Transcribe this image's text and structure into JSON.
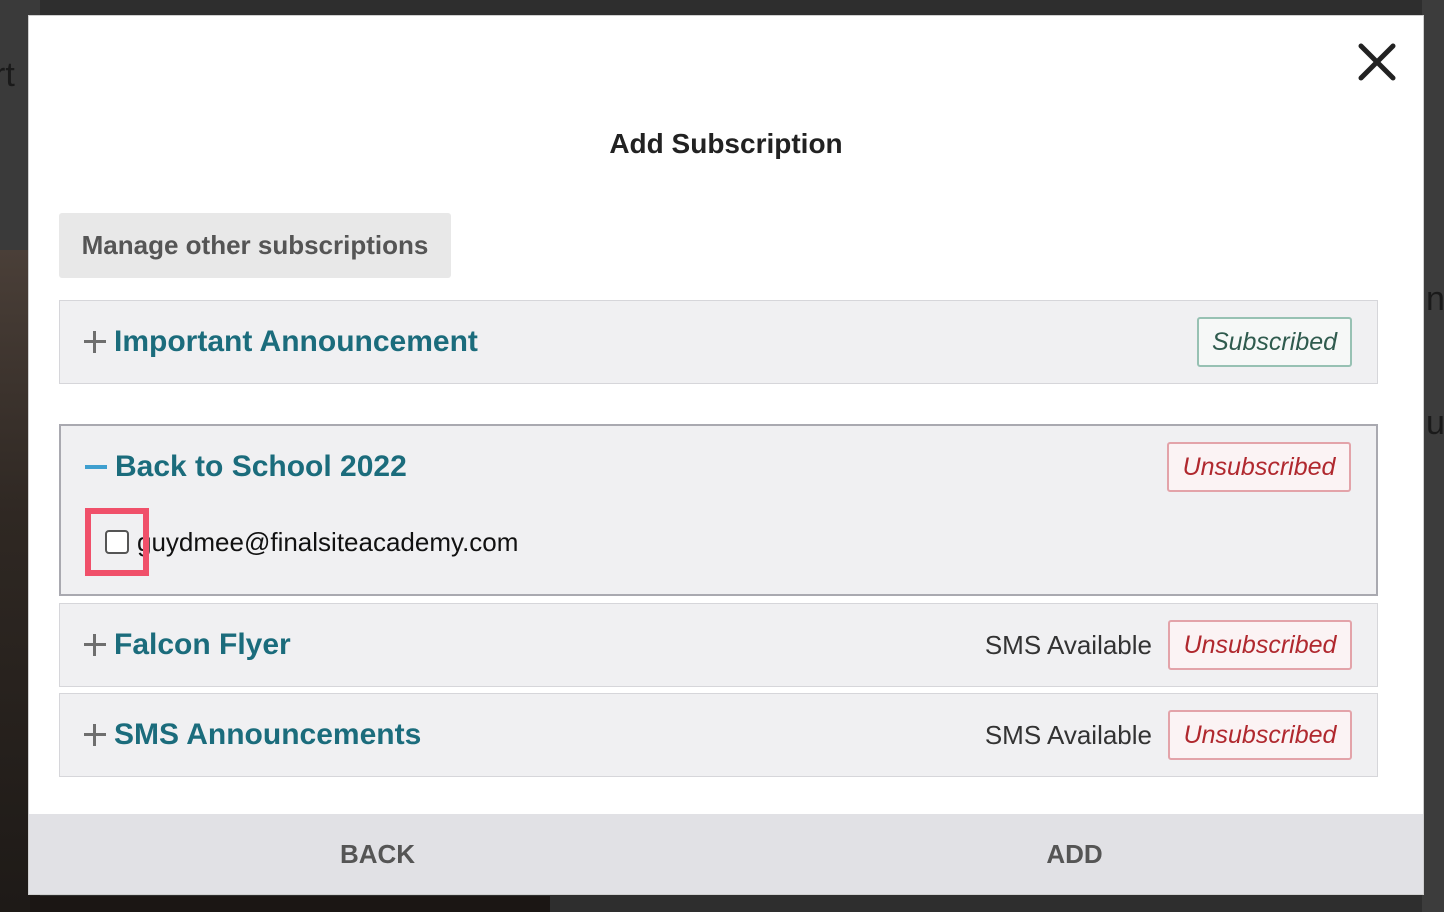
{
  "dialog": {
    "title": "Add Subscription",
    "manage_button": "Manage other subscriptions",
    "sms_label": "SMS Available",
    "subscriptions": [
      {
        "name": "Important Announcement",
        "status": "Subscribed",
        "expanded": false
      },
      {
        "name": "Back to School 2022",
        "status": "Unsubscribed",
        "expanded": true,
        "email": "guydmee@finalsiteacademy.com"
      },
      {
        "name": "Falcon Flyer",
        "status": "Unsubscribed",
        "expanded": false,
        "sms": true
      },
      {
        "name": "SMS Announcements",
        "status": "Unsubscribed",
        "expanded": false,
        "sms": true
      }
    ],
    "footer": {
      "back": "BACK",
      "add": "ADD"
    },
    "icons": {
      "close": "close-icon",
      "plus": "plus-icon",
      "minus": "minus-icon"
    },
    "colors": {
      "title_teal": "#1b6c7c",
      "subscribed": "#2f5b4e",
      "unsubscribed": "#b0282e",
      "highlight": "#f0506a",
      "minus_blue": "#3f9fcf"
    }
  },
  "background": {
    "fragments": [
      "rt",
      "n",
      "us"
    ]
  }
}
